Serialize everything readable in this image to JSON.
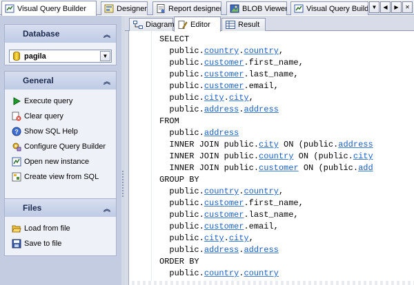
{
  "doc_tabs": [
    {
      "label": "Visual Query Builder",
      "active": true,
      "icon": "query-builder-icon"
    },
    {
      "label": "Designer",
      "active": false,
      "icon": "designer-icon"
    },
    {
      "label": "Report designer",
      "active": false,
      "icon": "report-icon"
    },
    {
      "label": "BLOB Viewer",
      "active": false,
      "icon": "blob-icon"
    },
    {
      "label": "Visual Query Builde",
      "active": false,
      "icon": "query-builder-icon"
    }
  ],
  "nav": {
    "menu": "▼",
    "prev": "◀",
    "next": "▶",
    "close": "✕"
  },
  "database": {
    "header": "Database",
    "selected": "pagila"
  },
  "general": {
    "header": "General",
    "items": [
      {
        "label": "Execute query",
        "icon": "play-icon"
      },
      {
        "label": "Clear query",
        "icon": "clear-icon"
      },
      {
        "label": "Show SQL Help",
        "icon": "help-icon"
      },
      {
        "label": "Configure Query Builder",
        "icon": "configure-icon"
      },
      {
        "label": "Open new instance",
        "icon": "new-instance-icon"
      },
      {
        "label": "Create view from SQL",
        "icon": "create-view-icon"
      }
    ]
  },
  "files": {
    "header": "Files",
    "items": [
      {
        "label": "Load from file",
        "icon": "open-folder-icon"
      },
      {
        "label": "Save to file",
        "icon": "save-icon"
      }
    ]
  },
  "sub_tabs": [
    {
      "label": "Diagram",
      "active": false
    },
    {
      "label": "Editor",
      "active": true
    },
    {
      "label": "Result",
      "active": false
    }
  ],
  "sql_lines": [
    [
      {
        "t": "SELECT",
        "k": "kw"
      }
    ],
    [
      {
        "t": "  public.",
        "k": "tx"
      },
      {
        "t": "country",
        "k": "id"
      },
      {
        "t": ".",
        "k": "tx"
      },
      {
        "t": "country",
        "k": "id"
      },
      {
        "t": ",",
        "k": "tx"
      }
    ],
    [
      {
        "t": "  public.",
        "k": "tx"
      },
      {
        "t": "customer",
        "k": "id"
      },
      {
        "t": ".first_name,",
        "k": "tx"
      }
    ],
    [
      {
        "t": "  public.",
        "k": "tx"
      },
      {
        "t": "customer",
        "k": "id"
      },
      {
        "t": ".last_name,",
        "k": "tx"
      }
    ],
    [
      {
        "t": "  public.",
        "k": "tx"
      },
      {
        "t": "customer",
        "k": "id"
      },
      {
        "t": ".email,",
        "k": "tx"
      }
    ],
    [
      {
        "t": "  public.",
        "k": "tx"
      },
      {
        "t": "city",
        "k": "id"
      },
      {
        "t": ".",
        "k": "tx"
      },
      {
        "t": "city",
        "k": "id"
      },
      {
        "t": ",",
        "k": "tx"
      }
    ],
    [
      {
        "t": "  public.",
        "k": "tx"
      },
      {
        "t": "address",
        "k": "id"
      },
      {
        "t": ".",
        "k": "tx"
      },
      {
        "t": "address",
        "k": "id"
      }
    ],
    [
      {
        "t": "FROM",
        "k": "kw"
      }
    ],
    [
      {
        "t": "  public.",
        "k": "tx"
      },
      {
        "t": "address",
        "k": "id"
      }
    ],
    [
      {
        "t": "  INNER JOIN public.",
        "k": "tx"
      },
      {
        "t": "city",
        "k": "id"
      },
      {
        "t": " ON (public.",
        "k": "tx"
      },
      {
        "t": "address",
        "k": "id"
      }
    ],
    [
      {
        "t": "  INNER JOIN public.",
        "k": "tx"
      },
      {
        "t": "country",
        "k": "id"
      },
      {
        "t": " ON (public.",
        "k": "tx"
      },
      {
        "t": "city",
        "k": "id"
      }
    ],
    [
      {
        "t": "  INNER JOIN public.",
        "k": "tx"
      },
      {
        "t": "customer",
        "k": "id"
      },
      {
        "t": " ON (public.",
        "k": "tx"
      },
      {
        "t": "add",
        "k": "id"
      }
    ],
    [
      {
        "t": "GROUP BY",
        "k": "kw"
      }
    ],
    [
      {
        "t": "  public.",
        "k": "tx"
      },
      {
        "t": "country",
        "k": "id"
      },
      {
        "t": ".",
        "k": "tx"
      },
      {
        "t": "country",
        "k": "id"
      },
      {
        "t": ",",
        "k": "tx"
      }
    ],
    [
      {
        "t": "  public.",
        "k": "tx"
      },
      {
        "t": "customer",
        "k": "id"
      },
      {
        "t": ".first_name,",
        "k": "tx"
      }
    ],
    [
      {
        "t": "  public.",
        "k": "tx"
      },
      {
        "t": "customer",
        "k": "id"
      },
      {
        "t": ".last_name,",
        "k": "tx"
      }
    ],
    [
      {
        "t": "  public.",
        "k": "tx"
      },
      {
        "t": "customer",
        "k": "id"
      },
      {
        "t": ".email,",
        "k": "tx"
      }
    ],
    [
      {
        "t": "  public.",
        "k": "tx"
      },
      {
        "t": "city",
        "k": "id"
      },
      {
        "t": ".",
        "k": "tx"
      },
      {
        "t": "city",
        "k": "id"
      },
      {
        "t": ",",
        "k": "tx"
      }
    ],
    [
      {
        "t": "  public.",
        "k": "tx"
      },
      {
        "t": "address",
        "k": "id"
      },
      {
        "t": ".",
        "k": "tx"
      },
      {
        "t": "address",
        "k": "id"
      }
    ],
    [
      {
        "t": "ORDER BY",
        "k": "kw"
      }
    ],
    [
      {
        "t": "  public.",
        "k": "tx"
      },
      {
        "t": "country",
        "k": "id"
      },
      {
        "t": ".",
        "k": "tx"
      },
      {
        "t": "country",
        "k": "id"
      }
    ]
  ],
  "colors": {
    "link": "#1a5fc4",
    "panel": "#c3cce1",
    "group": "#eef1f8"
  }
}
